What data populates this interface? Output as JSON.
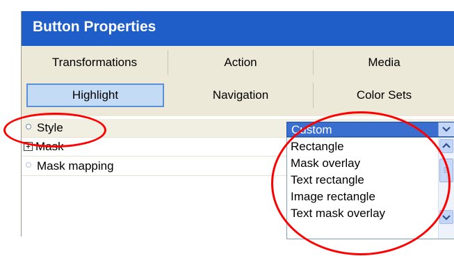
{
  "window": {
    "title": "Button Properties"
  },
  "tabs": {
    "row1": [
      "Transformations",
      "Action",
      "Media"
    ],
    "row2": [
      "Highlight",
      "Navigation",
      "Color Sets"
    ],
    "selected": "Highlight"
  },
  "properties": [
    {
      "label": "Style",
      "marker": "bullet"
    },
    {
      "label": "Mask",
      "marker": "expander",
      "expander_symbol": "+"
    },
    {
      "label": "Mask mapping",
      "marker": "bullet"
    }
  ],
  "style_dropdown": {
    "value": "Custom",
    "options": [
      "Rectangle",
      "Mask overlay",
      "Text rectangle",
      "Image rectangle",
      "Text mask overlay"
    ]
  },
  "icons": {
    "combo_button": "chevron-down-icon",
    "scroll_up": "chevron-up-icon",
    "scroll_down": "chevron-down-icon",
    "property_bullet": "circle-bullet-icon",
    "expand": "plus-box-icon"
  },
  "colors": {
    "title_bar": "#1f5ec9",
    "selected_tab": "#c3dbf4",
    "combo_highlight": "#3a6fd0",
    "annotation": "#ff0000"
  }
}
